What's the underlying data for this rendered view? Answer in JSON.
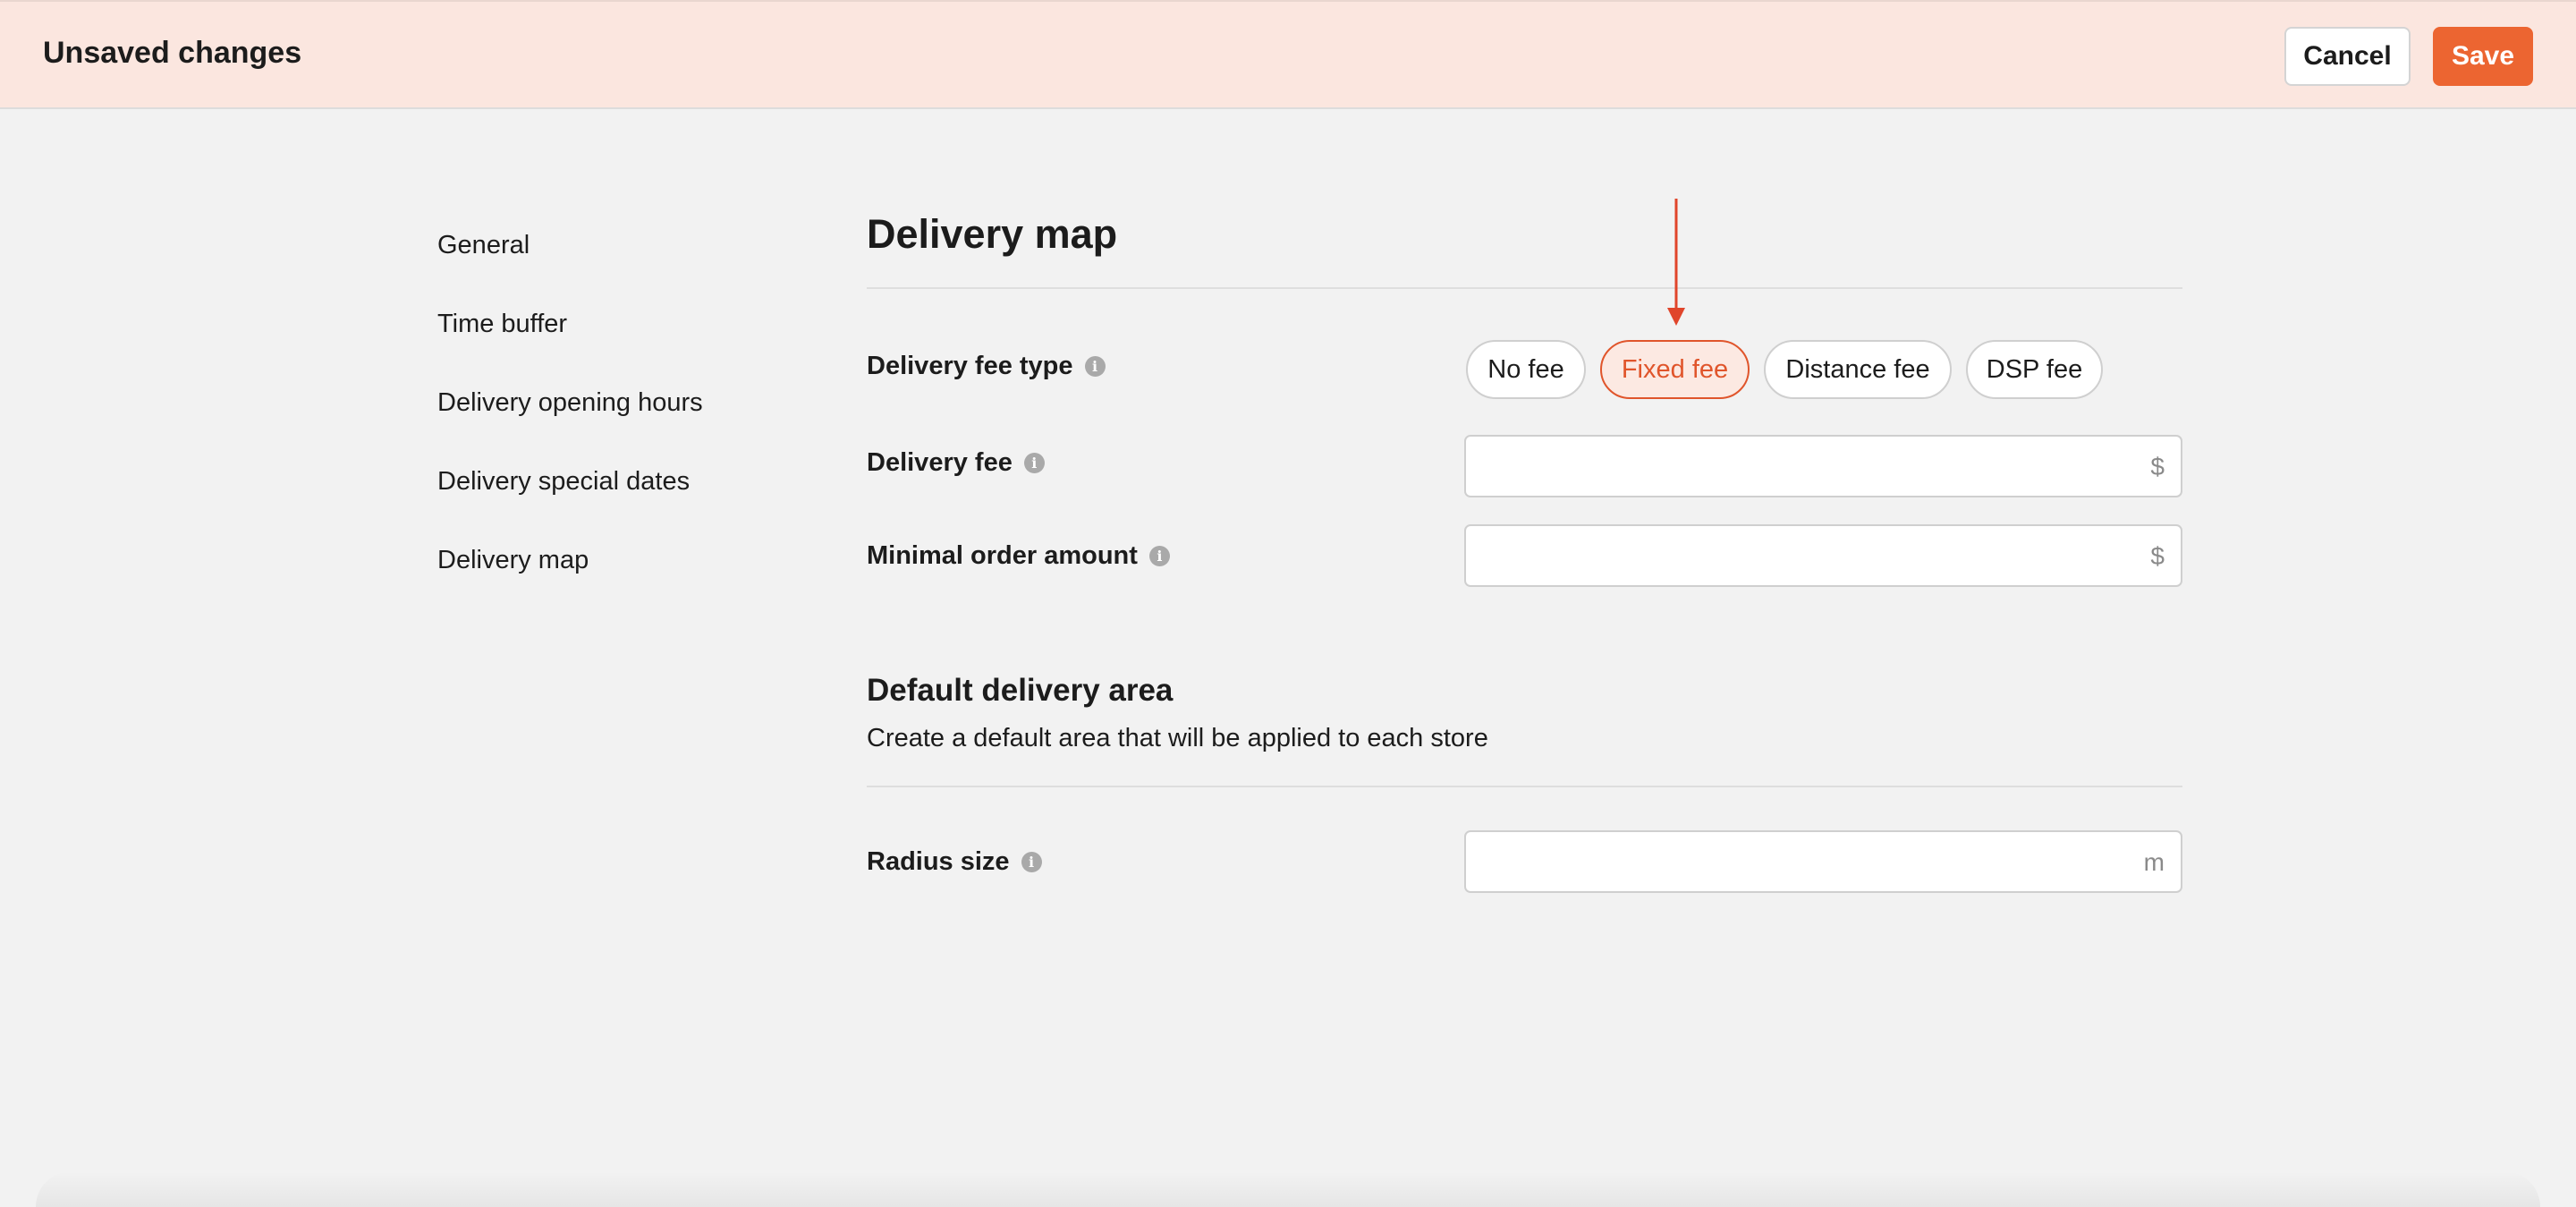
{
  "topbar": {
    "title": "Unsaved changes",
    "cancel_label": "Cancel",
    "save_label": "Save"
  },
  "sidebar": {
    "items": [
      {
        "label": "General"
      },
      {
        "label": "Time buffer"
      },
      {
        "label": "Delivery opening hours"
      },
      {
        "label": "Delivery special dates"
      },
      {
        "label": "Delivery map"
      }
    ]
  },
  "main": {
    "title": "Delivery map",
    "fee_type": {
      "label": "Delivery fee type",
      "options": [
        "No fee",
        "Fixed fee",
        "Distance fee",
        "DSP fee"
      ],
      "selected": "Fixed fee"
    },
    "delivery_fee": {
      "label": "Delivery fee",
      "value": "",
      "suffix": "$"
    },
    "minimal_order": {
      "label": "Minimal order amount",
      "value": "",
      "suffix": "$"
    },
    "default_area": {
      "title": "Default delivery area",
      "description": "Create a default area that will be applied to each store"
    },
    "radius": {
      "label": "Radius size",
      "value": "",
      "suffix": "m"
    }
  },
  "icons": {
    "info": "info-icon",
    "annotation": "arrow-down-icon"
  },
  "colors": {
    "accent": "#ec6531",
    "topbar_bg": "#fbe6df",
    "page_bg": "#f2f2f2",
    "annotation": "#e0452b"
  }
}
